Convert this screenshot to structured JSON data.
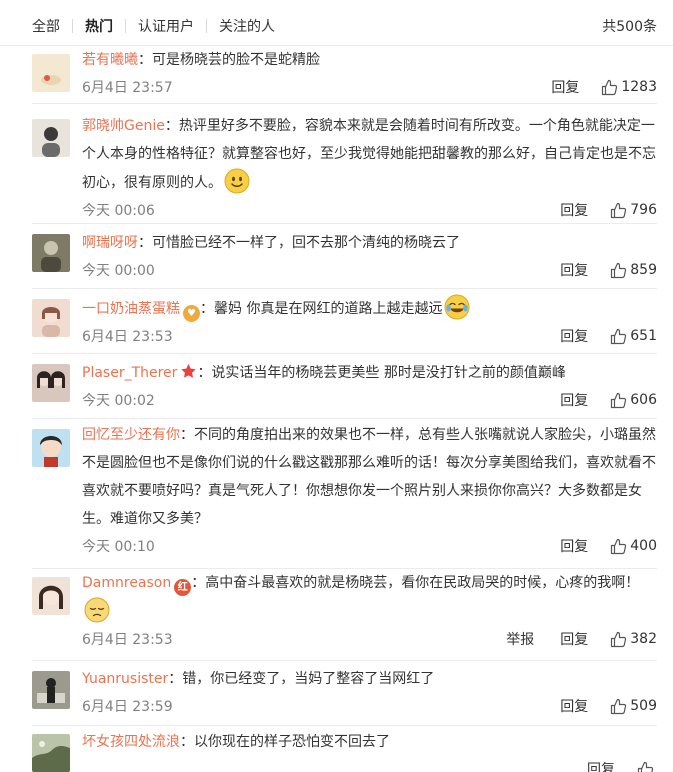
{
  "tabs": [
    {
      "label": "全部"
    },
    {
      "label": "热门",
      "active": true
    },
    {
      "label": "认证用户"
    },
    {
      "label": "关注的人"
    }
  ],
  "total_label": "共500条",
  "comments": [
    {
      "user": "若有曦曦",
      "text": "：可是杨晓芸的脸不是蛇精脸",
      "time": "6月4日 23:57",
      "reply": "回复",
      "likes": "1283",
      "avatar_color": "#f3e9d2",
      "avatar_accent": "#e2574c"
    },
    {
      "user": "郭晓帅Genie",
      "text": "：热评里好多不要脸，容貌本来就是会随着时间有所改变。一个角色就能决定一个人本身的性格特征？就算整容也好，至少我觉得她能把甜馨教的那么好，自己肯定也是不忘初心，很有原则的人。",
      "emoji": "smile-emoji",
      "time": "今天 00:06",
      "reply": "回复",
      "likes": "796",
      "avatar_color": "#e8e4dc",
      "avatar_accent": "#3a3a3a"
    },
    {
      "user": "啊瑞呀呀",
      "text": "：可惜脸已经不一样了，回不去那个清纯的杨晓云了",
      "time": "今天 00:00",
      "reply": "回复",
      "likes": "859",
      "avatar_color": "#7d7a66",
      "avatar_accent": "#c9c4b0"
    },
    {
      "user": "一口奶油蒸蛋糕",
      "badge": "heart-badge-icon",
      "text": "：馨妈 你真是在网红的道路上越走越远",
      "emoji": "laugh-cry-emoji",
      "time": "6月4日 23:53",
      "reply": "回复",
      "likes": "651",
      "avatar_color": "#f0dcd0",
      "avatar_accent": "#8a5a44"
    },
    {
      "user": "Plaser_Therer",
      "badge": "star-badge-icon",
      "text": "：说实话当年的杨晓芸更美些 那时是没打针之前的颜值巅峰",
      "time": "今天 00:02",
      "reply": "回复",
      "likes": "606",
      "avatar_color": "#d8c7bd",
      "avatar_accent": "#2d2222"
    },
    {
      "user": "回忆至少还有你",
      "text": "：不同的角度拍出来的效果也不一样，总有些人张嘴就说人家脸尖，小璐虽然不是圆脸但也不是像你们说的什么戳这戳那那么难听的话！每次分享美图给我们，喜欢就看不喜欢就不要喷好吗？真是气死人了！你想想你发一个照片别人来损你你高兴？大多数都是女生。难道你又多美？",
      "time": "今天 00:10",
      "reply": "回复",
      "likes": "400",
      "avatar_color": "#bfe0f0",
      "avatar_accent": "#c0392b"
    },
    {
      "user": "Damnreason",
      "badge": "red-badge-icon",
      "text": "：高中奋斗最喜欢的就是杨晓芸，看你在民政局哭的时候，心疼的我啊！",
      "emoji": "sad-emoji",
      "time": "6月4日 23:53",
      "report": "举报",
      "reply": "回复",
      "likes": "382",
      "avatar_color": "#efe3d8",
      "avatar_accent": "#3b2a22"
    },
    {
      "user": "Yuanrusister",
      "text": "：错，你已经变了，当妈了整容了当网红了",
      "time": "6月4日 23:59",
      "reply": "回复",
      "likes": "509",
      "avatar_color": "#9c9a8c",
      "avatar_accent": "#222222"
    },
    {
      "user": "坏女孩四处流浪",
      "text": "：以你现在的样子恐怕变不回去了",
      "time": "",
      "reply": "回复",
      "likes": "",
      "avatar_color": "#b9c4a8",
      "avatar_accent": "#5e6b4a"
    }
  ],
  "colors": {
    "username": "#eb7350",
    "meta": "#808080",
    "divider": "#ececec"
  }
}
